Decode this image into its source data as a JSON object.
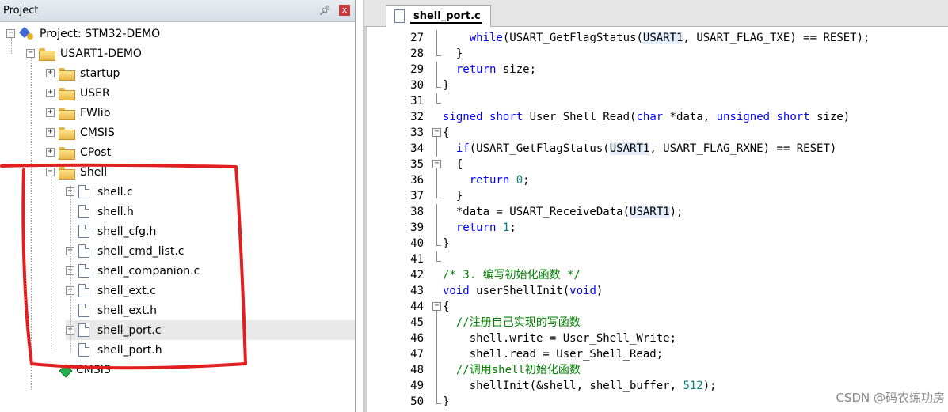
{
  "project_panel": {
    "title": "Project",
    "pin_icon": "pin-icon",
    "close_label": "x",
    "tree": [
      {
        "label": "Project: STM32-DEMO",
        "kind": "project"
      },
      {
        "label": "USART1-DEMO",
        "kind": "target"
      },
      {
        "label": "startup",
        "kind": "folder"
      },
      {
        "label": "USER",
        "kind": "folder"
      },
      {
        "label": "FWlib",
        "kind": "folder"
      },
      {
        "label": "CMSIS",
        "kind": "folder"
      },
      {
        "label": "CPost",
        "kind": "folder"
      },
      {
        "label": "Shell",
        "kind": "folder-open"
      },
      {
        "label": "shell.c",
        "kind": "file"
      },
      {
        "label": "shell.h",
        "kind": "file"
      },
      {
        "label": "shell_cfg.h",
        "kind": "file"
      },
      {
        "label": "shell_cmd_list.c",
        "kind": "file"
      },
      {
        "label": "shell_companion.c",
        "kind": "file"
      },
      {
        "label": "shell_ext.c",
        "kind": "file"
      },
      {
        "label": "shell_ext.h",
        "kind": "file"
      },
      {
        "label": "shell_port.c",
        "kind": "file",
        "selected": true
      },
      {
        "label": "shell_port.h",
        "kind": "file"
      },
      {
        "label": "CMSIS",
        "kind": "component"
      }
    ],
    "annotation_color": "#e02020"
  },
  "editor": {
    "tab_label": "shell_port.c",
    "lines": [
      {
        "n": "27",
        "tokens": [
          [
            "    ",
            ""
          ],
          [
            "while",
            "kw"
          ],
          [
            "(USART_GetFlagStatus(",
            ""
          ],
          [
            "USART1",
            "hl"
          ],
          [
            ", USART_FLAG_TXE) == RESET);",
            ""
          ]
        ]
      },
      {
        "n": "28",
        "tokens": [
          [
            "  }",
            ""
          ]
        ]
      },
      {
        "n": "29",
        "tokens": [
          [
            "  ",
            ""
          ],
          [
            "return",
            "kw"
          ],
          [
            " size;",
            ""
          ]
        ]
      },
      {
        "n": "30",
        "tokens": [
          [
            "}",
            ""
          ]
        ]
      },
      {
        "n": "31",
        "tokens": []
      },
      {
        "n": "32",
        "tokens": [
          [
            "signed",
            "kw"
          ],
          [
            " ",
            ""
          ],
          [
            "short",
            "kw"
          ],
          [
            " User_Shell_Read(",
            ""
          ],
          [
            "char",
            "kw"
          ],
          [
            " *data, ",
            ""
          ],
          [
            "unsigned",
            "kw"
          ],
          [
            " ",
            ""
          ],
          [
            "short",
            "kw"
          ],
          [
            " size)",
            ""
          ]
        ]
      },
      {
        "n": "33",
        "tokens": [
          [
            "{",
            ""
          ]
        ]
      },
      {
        "n": "34",
        "tokens": [
          [
            "  ",
            ""
          ],
          [
            "if",
            "kw"
          ],
          [
            "(USART_GetFlagStatus(",
            ""
          ],
          [
            "USART1",
            "hl"
          ],
          [
            ", USART_FLAG_RXNE) == RESET)",
            ""
          ]
        ]
      },
      {
        "n": "35",
        "tokens": [
          [
            "  {",
            ""
          ]
        ]
      },
      {
        "n": "36",
        "tokens": [
          [
            "    ",
            ""
          ],
          [
            "return",
            "kw"
          ],
          [
            " ",
            ""
          ],
          [
            "0",
            "num"
          ],
          [
            ";",
            ""
          ]
        ]
      },
      {
        "n": "37",
        "tokens": [
          [
            "  }",
            ""
          ]
        ]
      },
      {
        "n": "38",
        "tokens": [
          [
            "  *data = USART_ReceiveData(",
            ""
          ],
          [
            "USART1",
            "hl"
          ],
          [
            ");",
            ""
          ]
        ]
      },
      {
        "n": "39",
        "tokens": [
          [
            "  ",
            ""
          ],
          [
            "return",
            "kw"
          ],
          [
            " ",
            ""
          ],
          [
            "1",
            "num"
          ],
          [
            ";",
            ""
          ]
        ]
      },
      {
        "n": "40",
        "tokens": [
          [
            "}",
            ""
          ]
        ]
      },
      {
        "n": "41",
        "tokens": []
      },
      {
        "n": "42",
        "tokens": [
          [
            "/* 3. 编写初始化函数 */",
            "cm"
          ]
        ]
      },
      {
        "n": "43",
        "tokens": [
          [
            "void",
            "kw"
          ],
          [
            " userShellInit(",
            ""
          ],
          [
            "void",
            "kw"
          ],
          [
            ")",
            ""
          ]
        ]
      },
      {
        "n": "44",
        "tokens": [
          [
            "{",
            ""
          ]
        ]
      },
      {
        "n": "45",
        "tokens": [
          [
            "  ",
            ""
          ],
          [
            "//注册自己实现的写函数",
            "cm"
          ]
        ]
      },
      {
        "n": "46",
        "tokens": [
          [
            "    shell.write = User_Shell_Write;",
            ""
          ]
        ]
      },
      {
        "n": "47",
        "tokens": [
          [
            "    shell.read = User_Shell_Read;",
            ""
          ]
        ]
      },
      {
        "n": "48",
        "tokens": [
          [
            "  ",
            ""
          ],
          [
            "//调用shell初始化函数",
            "cm"
          ]
        ]
      },
      {
        "n": "49",
        "tokens": [
          [
            "    shellInit(&shell, shell_buffer, ",
            ""
          ],
          [
            "512",
            "num"
          ],
          [
            ");",
            ""
          ]
        ]
      },
      {
        "n": "50",
        "tokens": [
          [
            "}",
            ""
          ]
        ]
      }
    ]
  },
  "watermark": "CSDN @码农练功房"
}
